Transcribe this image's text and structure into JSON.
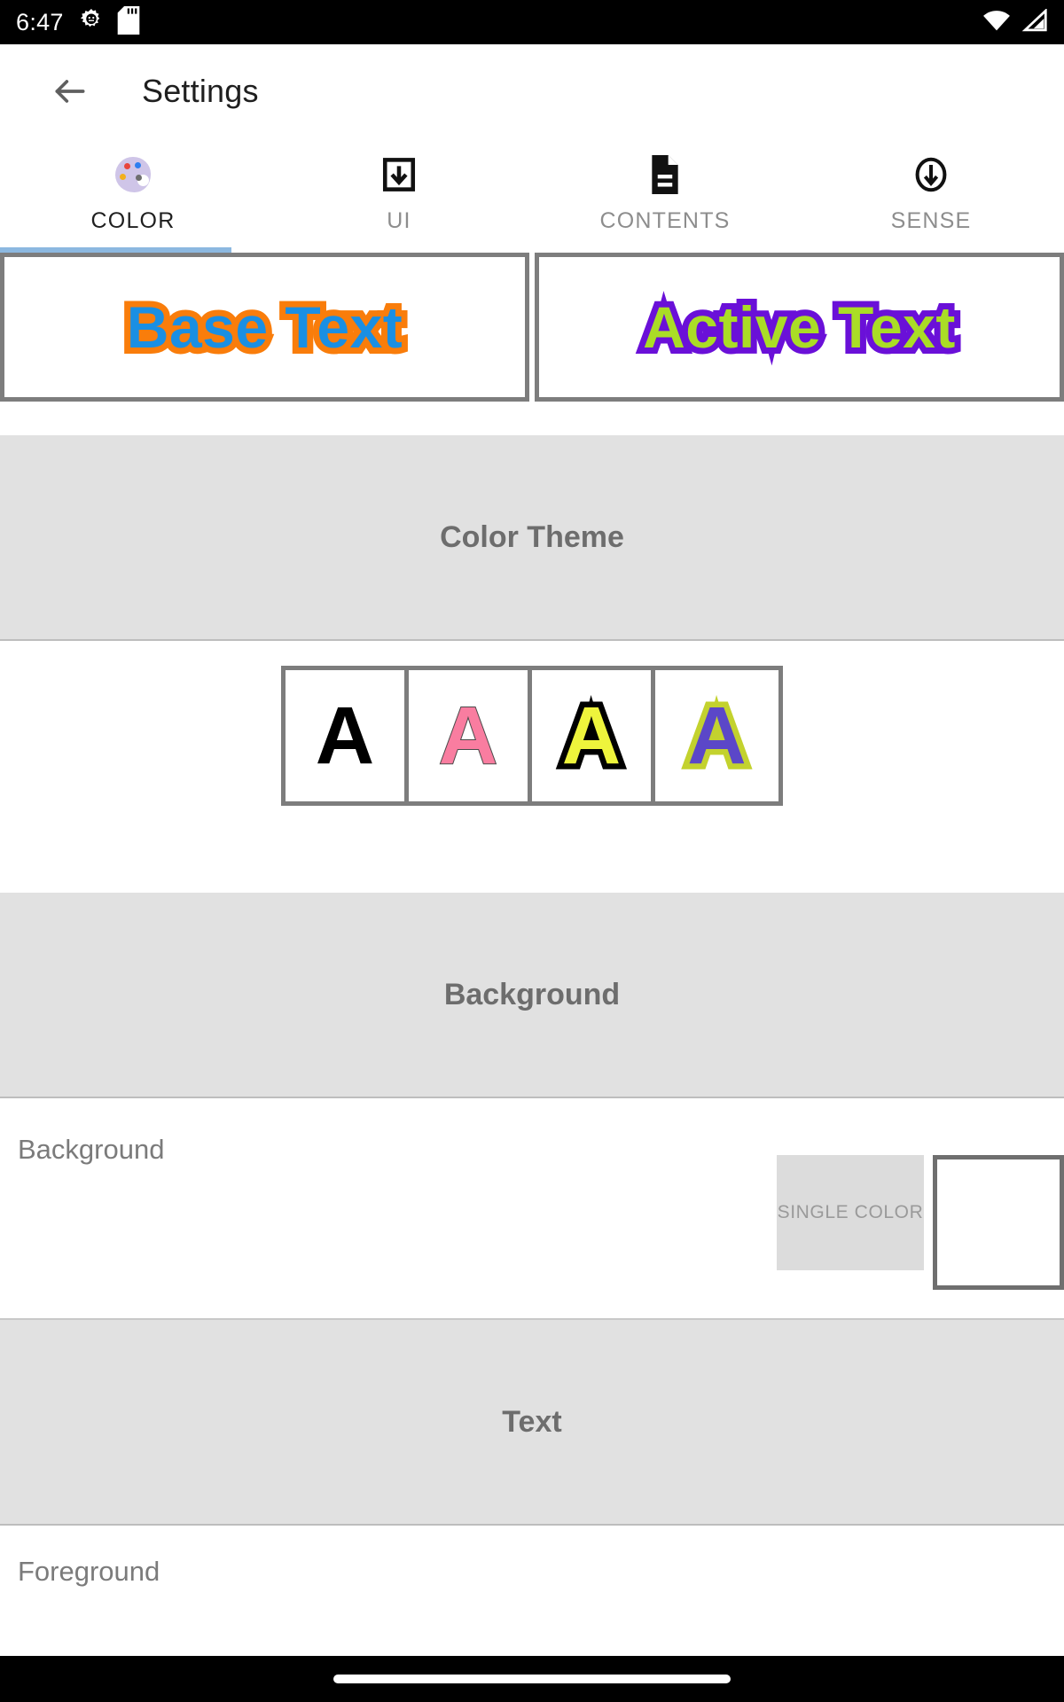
{
  "status_bar": {
    "time": "6:47",
    "left_icons": [
      "android-gear-icon",
      "sd-card-icon"
    ],
    "right_icons": [
      "wifi-icon",
      "cell-signal-icon"
    ],
    "background_color": "#000000"
  },
  "app_bar": {
    "back_icon": "back-arrow-icon",
    "title": "Settings"
  },
  "tabs": {
    "active_index": 0,
    "indicator_color": "#8cb8e0",
    "items": [
      {
        "label": "COLOR",
        "icon": "palette-icon"
      },
      {
        "label": "UI",
        "icon": "download-box-icon"
      },
      {
        "label": "CONTENTS",
        "icon": "document-icon"
      },
      {
        "label": "SENSE",
        "icon": "circle-down-arrow-icon"
      }
    ]
  },
  "preview": {
    "base": {
      "text": "Base Text",
      "fill_color": "#1a8fe3",
      "outline_color": "#f97d0b"
    },
    "active": {
      "text": "Active Text",
      "fill_color": "#aadd26",
      "outline_color": "#6a10d8"
    }
  },
  "sections": {
    "color_theme": {
      "title": "Color Theme",
      "swatches": [
        {
          "glyph": "A",
          "name": "theme-black",
          "fill": "#000000",
          "outline": "none"
        },
        {
          "glyph": "A",
          "name": "theme-pink",
          "fill": "#f97da0",
          "outline": "#4a4a4a"
        },
        {
          "glyph": "A",
          "name": "theme-yellow-black",
          "fill": "#eef43c",
          "outline": "#000000"
        },
        {
          "glyph": "A",
          "name": "theme-purple-lime",
          "fill": "#5b47c8",
          "outline": "#c3d22e"
        }
      ]
    },
    "background": {
      "title": "Background",
      "row_label": "Background",
      "mode_chip": "SINGLE COLOR",
      "color_value": "#ffffff"
    },
    "text": {
      "title": "Text",
      "row_label": "Foreground"
    }
  },
  "nav_bar": {
    "gesture_pill": "home-gesture-pill"
  }
}
